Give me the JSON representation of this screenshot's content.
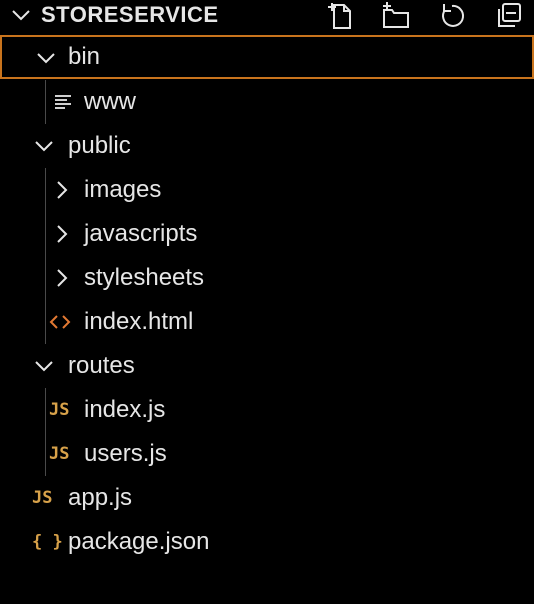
{
  "explorer": {
    "title": "STORESERVICE",
    "actions": {
      "new_file": "new-file-icon",
      "new_folder": "new-folder-icon",
      "refresh": "refresh-icon",
      "collapse_all": "collapse-all-icon"
    },
    "tree": {
      "bin": {
        "label": "bin",
        "expanded": true,
        "selected": true
      },
      "www": {
        "label": "www",
        "icon": "text-file-icon"
      },
      "public": {
        "label": "public",
        "expanded": true
      },
      "images": {
        "label": "images",
        "expanded": false
      },
      "javascripts": {
        "label": "javascripts",
        "expanded": false
      },
      "stylesheets": {
        "label": "stylesheets",
        "expanded": false
      },
      "index_html": {
        "label": "index.html",
        "icon": "html-file-icon"
      },
      "routes": {
        "label": "routes",
        "expanded": true
      },
      "index_js": {
        "label": "index.js",
        "icon_text": "JS"
      },
      "users_js": {
        "label": "users.js",
        "icon_text": "JS"
      },
      "app_js": {
        "label": "app.js",
        "icon_text": "JS"
      },
      "package_json": {
        "label": "package.json",
        "icon_text": "{ }"
      }
    }
  },
  "colors": {
    "background": "#000000",
    "text": "#e6e6e6",
    "selection_border": "#c9741d",
    "js_icon": "#d8a24a",
    "html_icon": "#e37933",
    "indent_guide": "#4a4a4a"
  }
}
